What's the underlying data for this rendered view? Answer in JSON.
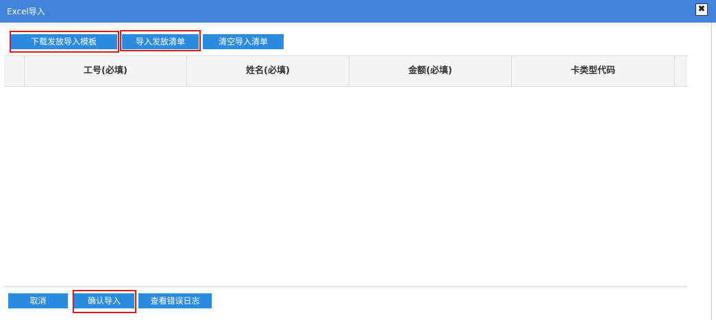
{
  "dialog": {
    "title": "Excel导入",
    "close_icon": "✖"
  },
  "toolbar": {
    "download_template": "下载发放导入模板",
    "import_list": "导入发放清单",
    "clear_list": "清空导入清单"
  },
  "grid": {
    "columns": [
      "工号(必填)",
      "姓名(必填)",
      "金额(必填)",
      "卡类型代码"
    ],
    "rows": []
  },
  "footer": {
    "cancel": "取消",
    "confirm_import": "确认导入",
    "view_error_log": "查看错误日志"
  },
  "colors": {
    "titlebar": "#3f84dd",
    "button": "#2b8be0",
    "highlight": "#e01818",
    "header_bg": "#f4f4f4"
  }
}
